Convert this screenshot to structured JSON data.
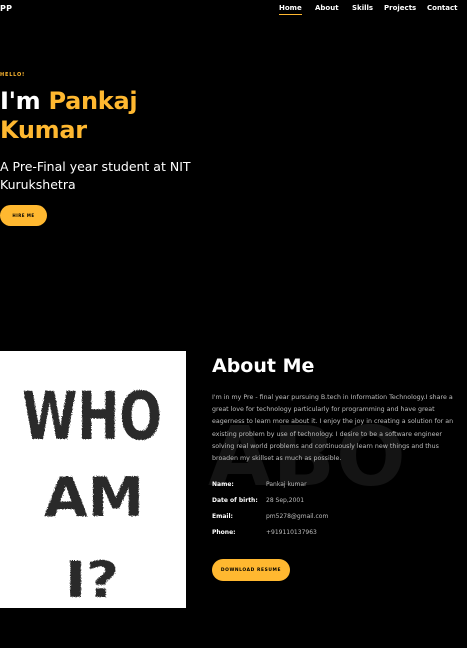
{
  "nav": {
    "logo": "PP",
    "items": [
      {
        "label": "Home",
        "active": true
      },
      {
        "label": "About"
      },
      {
        "label": "Skills"
      },
      {
        "label": "Projects"
      },
      {
        "label": "Contact"
      }
    ]
  },
  "hero": {
    "greeting": "HELLO!",
    "title_prefix": "I'm ",
    "name": "Pankaj Kumar",
    "subtitle": "A Pre-Final year student at NIT Kurukshetra",
    "cta": "HIRE ME"
  },
  "about": {
    "title": "About Me",
    "background_word": "ABO",
    "image_text": [
      "WHO",
      "AM",
      "I?"
    ],
    "description": "I'm in my Pre - final year pursuing B.tech in Information Technology.I share a great love for technology particularly for programming and have great eagerness to learn more about it. I enjoy the joy in creating a solution for an existing problem by use of technology. I desire to be a software engineer solving real world problems and continuously learn new things and thus broaden my skillset as much as possible.",
    "info": [
      {
        "label": "Name:",
        "value": "Pankaj kumar"
      },
      {
        "label": "Date of birth:",
        "value": "28 Sep,2001"
      },
      {
        "label": "Email:",
        "value": "pm5278@gmail.com"
      },
      {
        "label": "Phone:",
        "value": "+919110137963"
      }
    ],
    "download_cta": "DOWNLOAD RESUME"
  },
  "colors": {
    "accent": "#ffb830",
    "background": "#000000"
  }
}
